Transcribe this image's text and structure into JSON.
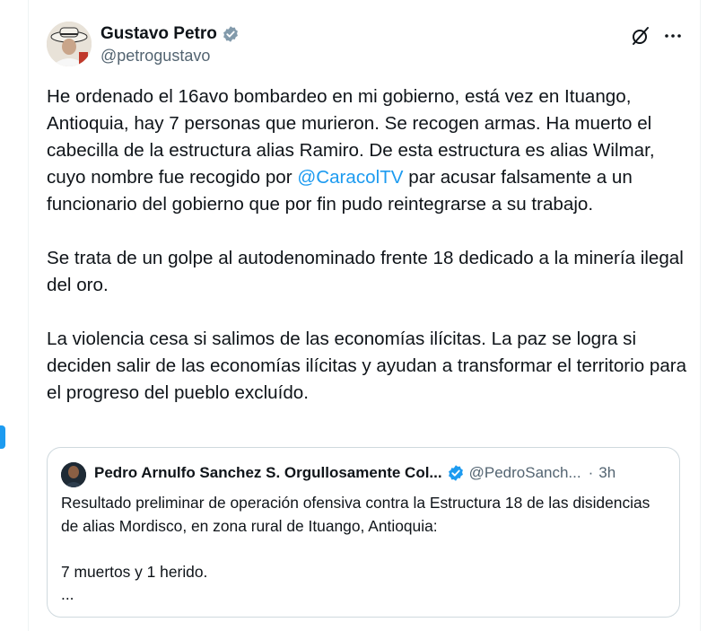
{
  "author": {
    "name": "Gustavo Petro",
    "handle": "@petrogustavo"
  },
  "icons": {
    "verified": "verified-badge-icon",
    "grok": "grok-icon",
    "more": "more-options-icon",
    "accent_color": "#1d9bf0"
  },
  "tweet": {
    "p1_before": "He ordenado el 16avo bombardeo en mi gobierno, está vez en Ituango, Antioquia, hay 7 personas que murieron. Se recogen armas. Ha muerto el cabecilla de la estructura alias Ramiro. De esta estructura es alias Wilmar, cuyo nombre fue recogido por ",
    "p1_mention": "@CaracolTV",
    "p1_after": " par acusar falsamente a un funcionario del gobierno que por fin pudo reintegrarse a su trabajo.",
    "p2": "Se trata de un golpe al autodenominado frente 18 dedicado a la minería ilegal del oro.",
    "p3": "La violencia cesa si salimos de las economías ilícitas. La paz se logra si deciden salir de las economías ilícitas y ayudan a transformar el territorio para el progreso del pueblo excluído."
  },
  "quote": {
    "name": "Pedro Arnulfo Sanchez S. Orgullosamente Col...",
    "handle": "@PedroSanch...",
    "dot": "·",
    "time": "3h",
    "line1": "Resultado preliminar de operación ofensiva contra la Estructura 18 de las disidencias de alias Mordisco, en zona rural de Ituango, Antioquia:",
    "line2": "7 muertos y 1 herido.",
    "line3": "..."
  }
}
